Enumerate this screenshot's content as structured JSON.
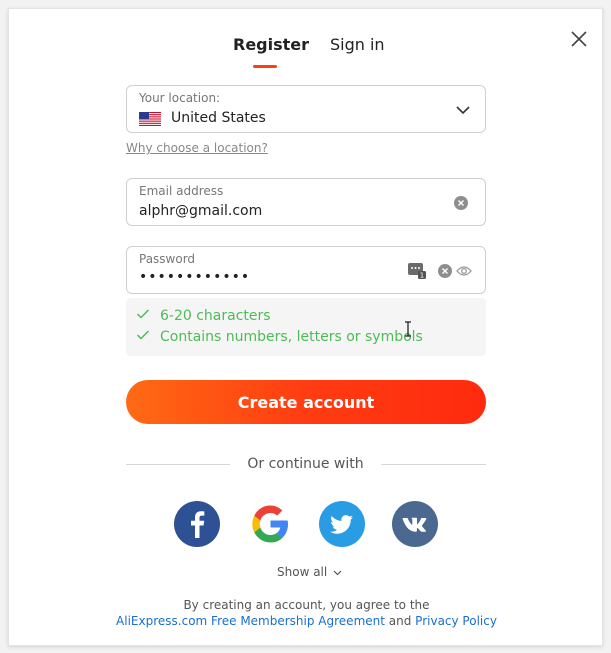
{
  "tabs": {
    "register": "Register",
    "signin": "Sign in"
  },
  "location": {
    "label": "Your location:",
    "value": "United States",
    "flag_icon": "us-flag-icon"
  },
  "why_location": "Why choose a location?",
  "email": {
    "label": "Email address",
    "value": "alphr@gmail.com"
  },
  "password": {
    "label": "Password",
    "value": "••••••••••••"
  },
  "hints": [
    "6-20 characters",
    "Contains numbers, letters or symbols"
  ],
  "create_button": "Create account",
  "or_continue": "Or continue with",
  "social": [
    "facebook",
    "google",
    "twitter",
    "vk"
  ],
  "show_all": "Show all",
  "terms": {
    "line1": "By creating an account, you agree to the",
    "agreement": "AliExpress.com Free Membership Agreement",
    "and": " and ",
    "privacy": "Privacy Policy"
  },
  "colors": {
    "accent": "#fd3e17",
    "hint_green": "#4dbb57",
    "link": "#1a6fd0"
  }
}
